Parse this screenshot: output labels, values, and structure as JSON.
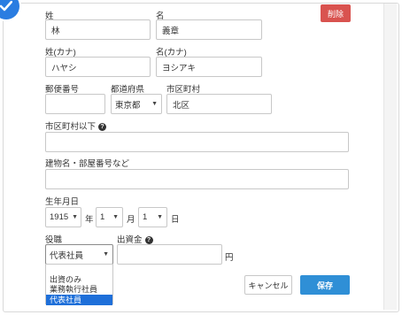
{
  "colors": {
    "accent": "#2f8fd6",
    "danger": "#d9534f",
    "selected": "#1e6fd9"
  },
  "icons": {
    "check": "check-circle-icon",
    "help": "question-circle-icon",
    "caret": "chevron-down-icon"
  },
  "form": {
    "delete_label": "削除",
    "last_name": {
      "label": "姓",
      "value": "林"
    },
    "first_name": {
      "label": "名",
      "value": "義章"
    },
    "last_name_kana": {
      "label": "姓(カナ)",
      "value": "ハヤシ"
    },
    "first_name_kana": {
      "label": "名(カナ)",
      "value": "ヨシアキ"
    },
    "postal_code": {
      "label": "郵便番号",
      "value": ""
    },
    "prefecture": {
      "label": "都道府県",
      "value": "東京都"
    },
    "city": {
      "label": "市区町村",
      "value": "北区"
    },
    "address_rest": {
      "label": "市区町村以下",
      "value": ""
    },
    "building": {
      "label": "建物名・部屋番号など",
      "value": ""
    },
    "birth": {
      "label": "生年月日",
      "year": "1915",
      "year_unit": "年",
      "month": "1",
      "month_unit": "月",
      "day": "1",
      "day_unit": "日"
    },
    "position": {
      "label": "役職",
      "value": "代表社員",
      "options": [
        "出資のみ",
        "業務執行社員",
        "代表社員"
      ]
    },
    "investment": {
      "label": "出資金",
      "value": "",
      "unit": "円"
    },
    "cancel_label": "キャンセル",
    "save_label": "保存"
  }
}
